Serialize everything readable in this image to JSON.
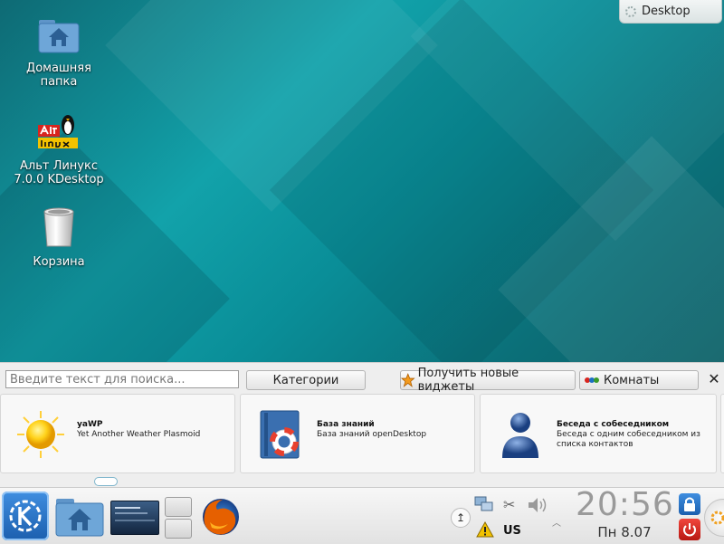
{
  "desktop": {
    "toolbox_label": "Desktop",
    "icons": [
      {
        "name": "home-folder",
        "label": "Домашняя\nпапка"
      },
      {
        "name": "alt-linux",
        "label": "Альт Линукс\n7.0.0 KDesktop"
      },
      {
        "name": "trash",
        "label": "Корзина"
      }
    ]
  },
  "widget_explorer": {
    "search_placeholder": "Введите текст для поиска...",
    "categories_label": "Категории",
    "get_widgets_label": "Получить новые виджеты",
    "activities_label": "Комнаты",
    "close_glyph": "✕",
    "widgets": [
      {
        "title": "yaWP",
        "description": "Yet Another Weather Plasmoid"
      },
      {
        "title": "База знаний",
        "description": "База знаний openDesktop"
      },
      {
        "title": "Беседа с собеседником",
        "description": "Беседа с одним собеседником из списка контактов"
      }
    ]
  },
  "panel": {
    "clock_time": "20:56",
    "clock_date": "Пн 8.07",
    "keyboard_layout": "US",
    "colors": {
      "accent": "#1c6fc4",
      "firefox": "#e66000",
      "logout": "#d8251e"
    }
  }
}
